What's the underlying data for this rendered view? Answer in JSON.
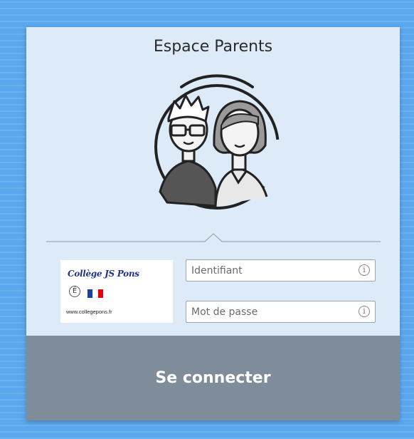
{
  "header": {
    "title": "Espace Parents"
  },
  "logo": {
    "school_name": "Collège JS Pons",
    "badge_letter": "É",
    "website": "www.collegepons.fr",
    "flag_colors": [
      "#1f3fa0",
      "#ffffff",
      "#e1000f"
    ]
  },
  "form": {
    "username_placeholder": "Identifiant",
    "password_placeholder": "Mot de passe",
    "info_glyph": "i",
    "submit_label": "Se connecter"
  },
  "icons": {
    "avatar": "parents-avatar-icon",
    "info": "info-icon"
  },
  "colors": {
    "background": "#5ba7ee",
    "card": "#ddeaf8",
    "button": "#7f8c99"
  }
}
